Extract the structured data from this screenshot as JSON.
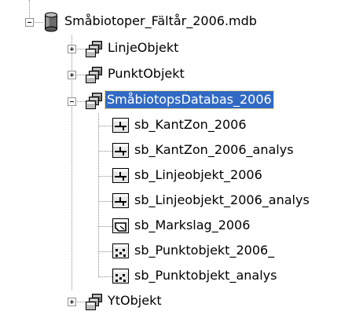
{
  "tree": {
    "database": {
      "label": "Småbiotoper_Fältår_2006.mdb",
      "expanded": true
    },
    "datasets": [
      {
        "label": "LinjeObjekt",
        "expanded": false
      },
      {
        "label": "PunktObjekt",
        "expanded": false
      },
      {
        "label": "SmåbiotopsDatabas_2006",
        "expanded": true,
        "selected": true
      },
      {
        "label": "YtObjekt",
        "expanded": false
      }
    ],
    "children": [
      {
        "label": "sb_KantZon_2006",
        "icon": "line-feature-class-icon"
      },
      {
        "label": "sb_KantZon_2006_analys",
        "icon": "line-feature-class-icon"
      },
      {
        "label": "sb_Linjeobjekt_2006",
        "icon": "line-feature-class-icon"
      },
      {
        "label": "sb_Linjeobjekt_2006_analys",
        "icon": "line-feature-class-icon"
      },
      {
        "label": "sb_Markslag_2006",
        "icon": "polygon-feature-class-icon"
      },
      {
        "label": "sb_Punktobjekt_2006_",
        "icon": "point-feature-class-icon"
      },
      {
        "label": "sb_Punktobjekt_analys",
        "icon": "point-feature-class-icon"
      }
    ]
  },
  "colors": {
    "selection": "#316ac5",
    "selection_text": "#ffffff",
    "tree_lines": "#8c8c8c"
  }
}
